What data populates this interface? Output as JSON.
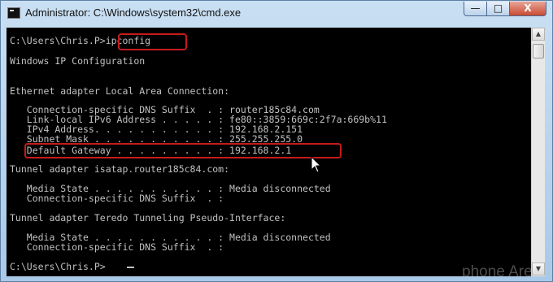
{
  "window": {
    "title": "Administrator: C:\\Windows\\system32\\cmd.exe",
    "minimize_label": "—",
    "maximize_label": "□",
    "close_label": "X"
  },
  "console": {
    "lines": [
      "C:\\Users\\Chris.P>ipconfig",
      "Windows IP Configuration",
      "",
      "Ethernet adapter Local Area Connection:",
      "",
      "   Connection-specific DNS Suffix  . : router185c84.com",
      "   Link-local IPv6 Address . . . . . : fe80::3859:669c:2f7a:669b%11",
      "   IPv4 Address. . . . . . . . . . . : 192.168.2.151",
      "   Subnet Mask . . . . . . . . . . . : 255.255.255.0",
      "   Default Gateway . . . . . . . . . : 192.168.2.1",
      "Tunnel adapter isatap.router185c84.com:",
      "",
      "   Media State . . . . . . . . . . . : Media disconnected",
      "   Connection-specific DNS Suffix  . :",
      "",
      "Tunnel adapter Teredo Tunneling Pseudo-Interface:",
      "",
      "   Media State . . . . . . . . . . . : Media disconnected",
      "   Connection-specific DNS Suffix  . :",
      "",
      "C:\\Users\\Chris.P>"
    ]
  },
  "watermark": "phone Arena",
  "colors": {
    "console_background": "#000000",
    "console_text": "#c0c0c0",
    "highlight_outline": "#c61b1b"
  }
}
